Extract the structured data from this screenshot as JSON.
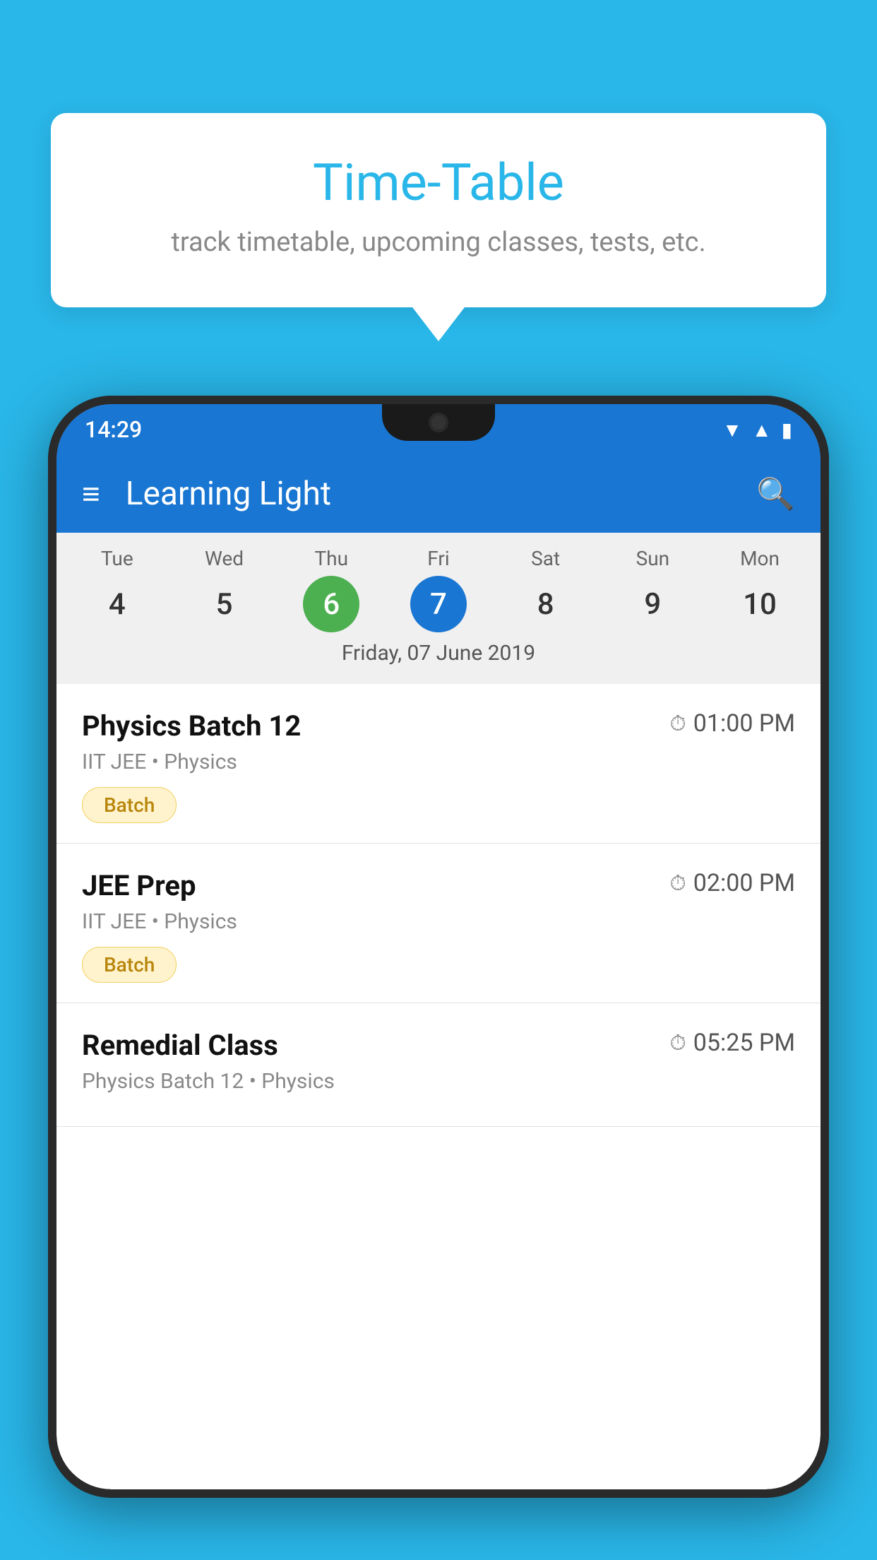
{
  "background_color": "#29B6E8",
  "tooltip": {
    "title": "Time-Table",
    "subtitle": "track timetable, upcoming classes, tests, etc."
  },
  "app": {
    "title": "Learning Light",
    "menu_label": "Menu",
    "search_label": "Search"
  },
  "status_bar": {
    "time": "14:29"
  },
  "calendar": {
    "selected_date_label": "Friday, 07 June 2019",
    "days": [
      {
        "name": "Tue",
        "num": "4",
        "state": "normal"
      },
      {
        "name": "Wed",
        "num": "5",
        "state": "normal"
      },
      {
        "name": "Thu",
        "num": "6",
        "state": "today"
      },
      {
        "name": "Fri",
        "num": "7",
        "state": "selected"
      },
      {
        "name": "Sat",
        "num": "8",
        "state": "normal"
      },
      {
        "name": "Sun",
        "num": "9",
        "state": "normal"
      },
      {
        "name": "Mon",
        "num": "10",
        "state": "normal"
      }
    ]
  },
  "classes": [
    {
      "name": "Physics Batch 12",
      "time": "01:00 PM",
      "course": "IIT JEE • Physics",
      "badge": "Batch"
    },
    {
      "name": "JEE Prep",
      "time": "02:00 PM",
      "course": "IIT JEE • Physics",
      "badge": "Batch"
    },
    {
      "name": "Remedial Class",
      "time": "05:25 PM",
      "course": "Physics Batch 12 • Physics",
      "badge": null
    }
  ]
}
